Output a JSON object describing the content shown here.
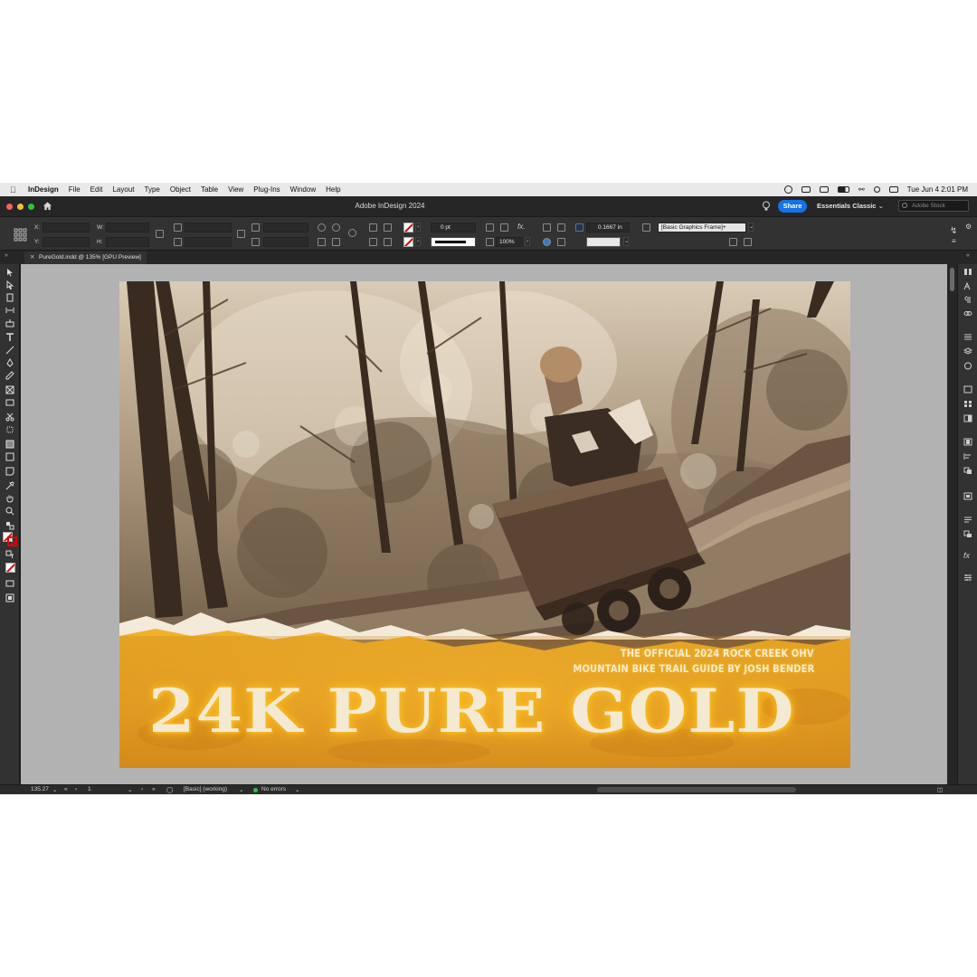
{
  "menubar": {
    "app_name": "InDesign",
    "items": [
      "File",
      "Edit",
      "Layout",
      "Type",
      "Object",
      "Table",
      "View",
      "Plug-Ins",
      "Window",
      "Help"
    ],
    "clock": "Tue Jun 4  2:01 PM"
  },
  "titlebar": {
    "title": "Adobe InDesign 2024",
    "share_label": "Share",
    "workspace_label": "Essentials Classic",
    "stock_placeholder": "Adobe Stock"
  },
  "control": {
    "x_label": "X:",
    "y_label": "Y:",
    "w_label": "W:",
    "h_label": "H:",
    "stroke_weight": "0 pt",
    "scale_percent": "100%",
    "fit_value": "0.1667 in",
    "object_style": "[Basic Graphics Frame]+"
  },
  "tab": {
    "label": "PureGold.indd @ 135% [GPU Preview]"
  },
  "document": {
    "subhead_line1": "THE OFFICIAL 2024 ROCK CREEK OHV",
    "subhead_line2": "MOUNTAIN BIKE TRAIL GUIDE BY JOSH BENDER",
    "headline": "24K PURE GOLD"
  },
  "status": {
    "zoom": "135.27",
    "page": "1",
    "preflight_profile": "[Basic] (working)",
    "errors": "No errors"
  },
  "colors": {
    "accent": "#1473e6",
    "gold": "#e6a923",
    "ok": "#2fbf4f"
  }
}
